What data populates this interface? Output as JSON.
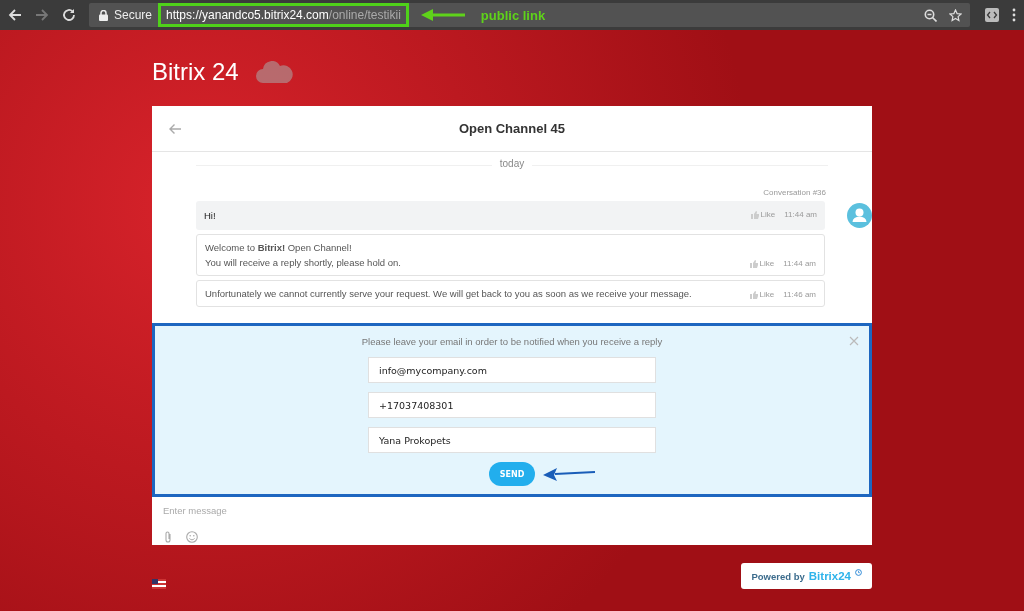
{
  "browser": {
    "secure_label": "Secure",
    "url_host": "https://yanandco5.bitrix24.com",
    "url_path": "/online/testikii",
    "annotation": "public link"
  },
  "logo": "Bitrix 24",
  "chat": {
    "title": "Open Channel 45",
    "date_divider": "today",
    "conversation_label": "Conversation #36",
    "messages": [
      {
        "kind": "outgoing",
        "lines": [
          "Hi!"
        ],
        "like": "Like",
        "time": "11:44 am"
      },
      {
        "kind": "incoming",
        "lines": [
          "Welcome to **Bitrix!** Open Channel!",
          "You will receive a reply shortly, please hold on."
        ],
        "like": "Like",
        "time": "11:44 am"
      },
      {
        "kind": "incoming",
        "lines": [
          "Unfortunately we cannot currently serve your request. We will get back to you as soon as we receive your message."
        ],
        "like": "Like",
        "time": "11:46 am"
      }
    ],
    "form": {
      "prompt": "Please leave your email in order to be notified when you receive a reply",
      "fields": [
        {
          "value": "info@mycompany.com"
        },
        {
          "value": "+17037408301"
        },
        {
          "value": "Yana Prokopets"
        }
      ],
      "button": "SEND"
    },
    "composer": {
      "placeholder": "Enter message"
    }
  },
  "powered": {
    "label": "Powered by",
    "brand": "Bitrix24"
  }
}
